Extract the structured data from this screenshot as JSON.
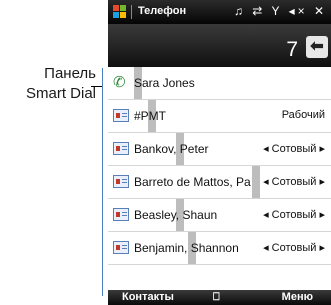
{
  "callout": {
    "line1": "Панель",
    "line2": "Smart Dial"
  },
  "statusbar": {
    "title": "Телефон",
    "icons_text": "♫ ⇄ Y ◂× ✕"
  },
  "dialpad": {
    "number": "7",
    "backspace_symbol": "⬅"
  },
  "list": [
    {
      "type": "call",
      "name": "Sara Jones",
      "label": ""
    },
    {
      "type": "contact",
      "name": "#PMT",
      "label": "Рабочий"
    },
    {
      "type": "contact",
      "name": "Bankov, Peter",
      "label": "◂ Сотовый ▸"
    },
    {
      "type": "contact",
      "name": "Barreto de Mattos, Pa",
      "label": "◂ Сотовый ▸"
    },
    {
      "type": "contact",
      "name": "Beasley, Shaun",
      "label": "◂ Сотовый ▸"
    },
    {
      "type": "contact",
      "name": "Benjamin, Shannon",
      "label": "◂ Сотовый ▸"
    }
  ],
  "softkeys": {
    "left": "Контакты",
    "right": "Меню"
  },
  "colors": {
    "accent_blue": "#4a7fc0",
    "highlight": "#bdbdbd"
  }
}
